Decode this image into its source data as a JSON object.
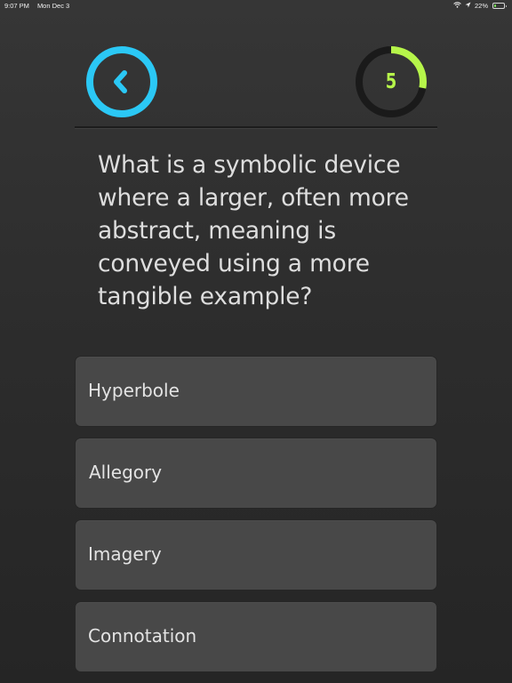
{
  "status_bar": {
    "time": "9:07 PM",
    "date": "Mon Dec 3",
    "battery_percent": "22%",
    "battery_level": 0.22,
    "icons": [
      "wifi-icon",
      "location-icon",
      "battery-icon"
    ]
  },
  "header": {
    "back_icon": "chevron-left-icon",
    "timer_value": "5",
    "timer_progress": 0.28
  },
  "colors": {
    "accent_back": "#2bc8f5",
    "timer_ring": "#b6f54a",
    "timer_track": "#1a1a1a",
    "background": "#2e2e2e",
    "answer_bg": "#484848"
  },
  "question": {
    "text": "What is a symbolic device where a larger, often more abstract, meaning is conveyed using a more tangible example?"
  },
  "answers": [
    {
      "label": "Hyperbole"
    },
    {
      "label": "Allegory"
    },
    {
      "label": "Imagery"
    },
    {
      "label": "Connotation"
    }
  ]
}
